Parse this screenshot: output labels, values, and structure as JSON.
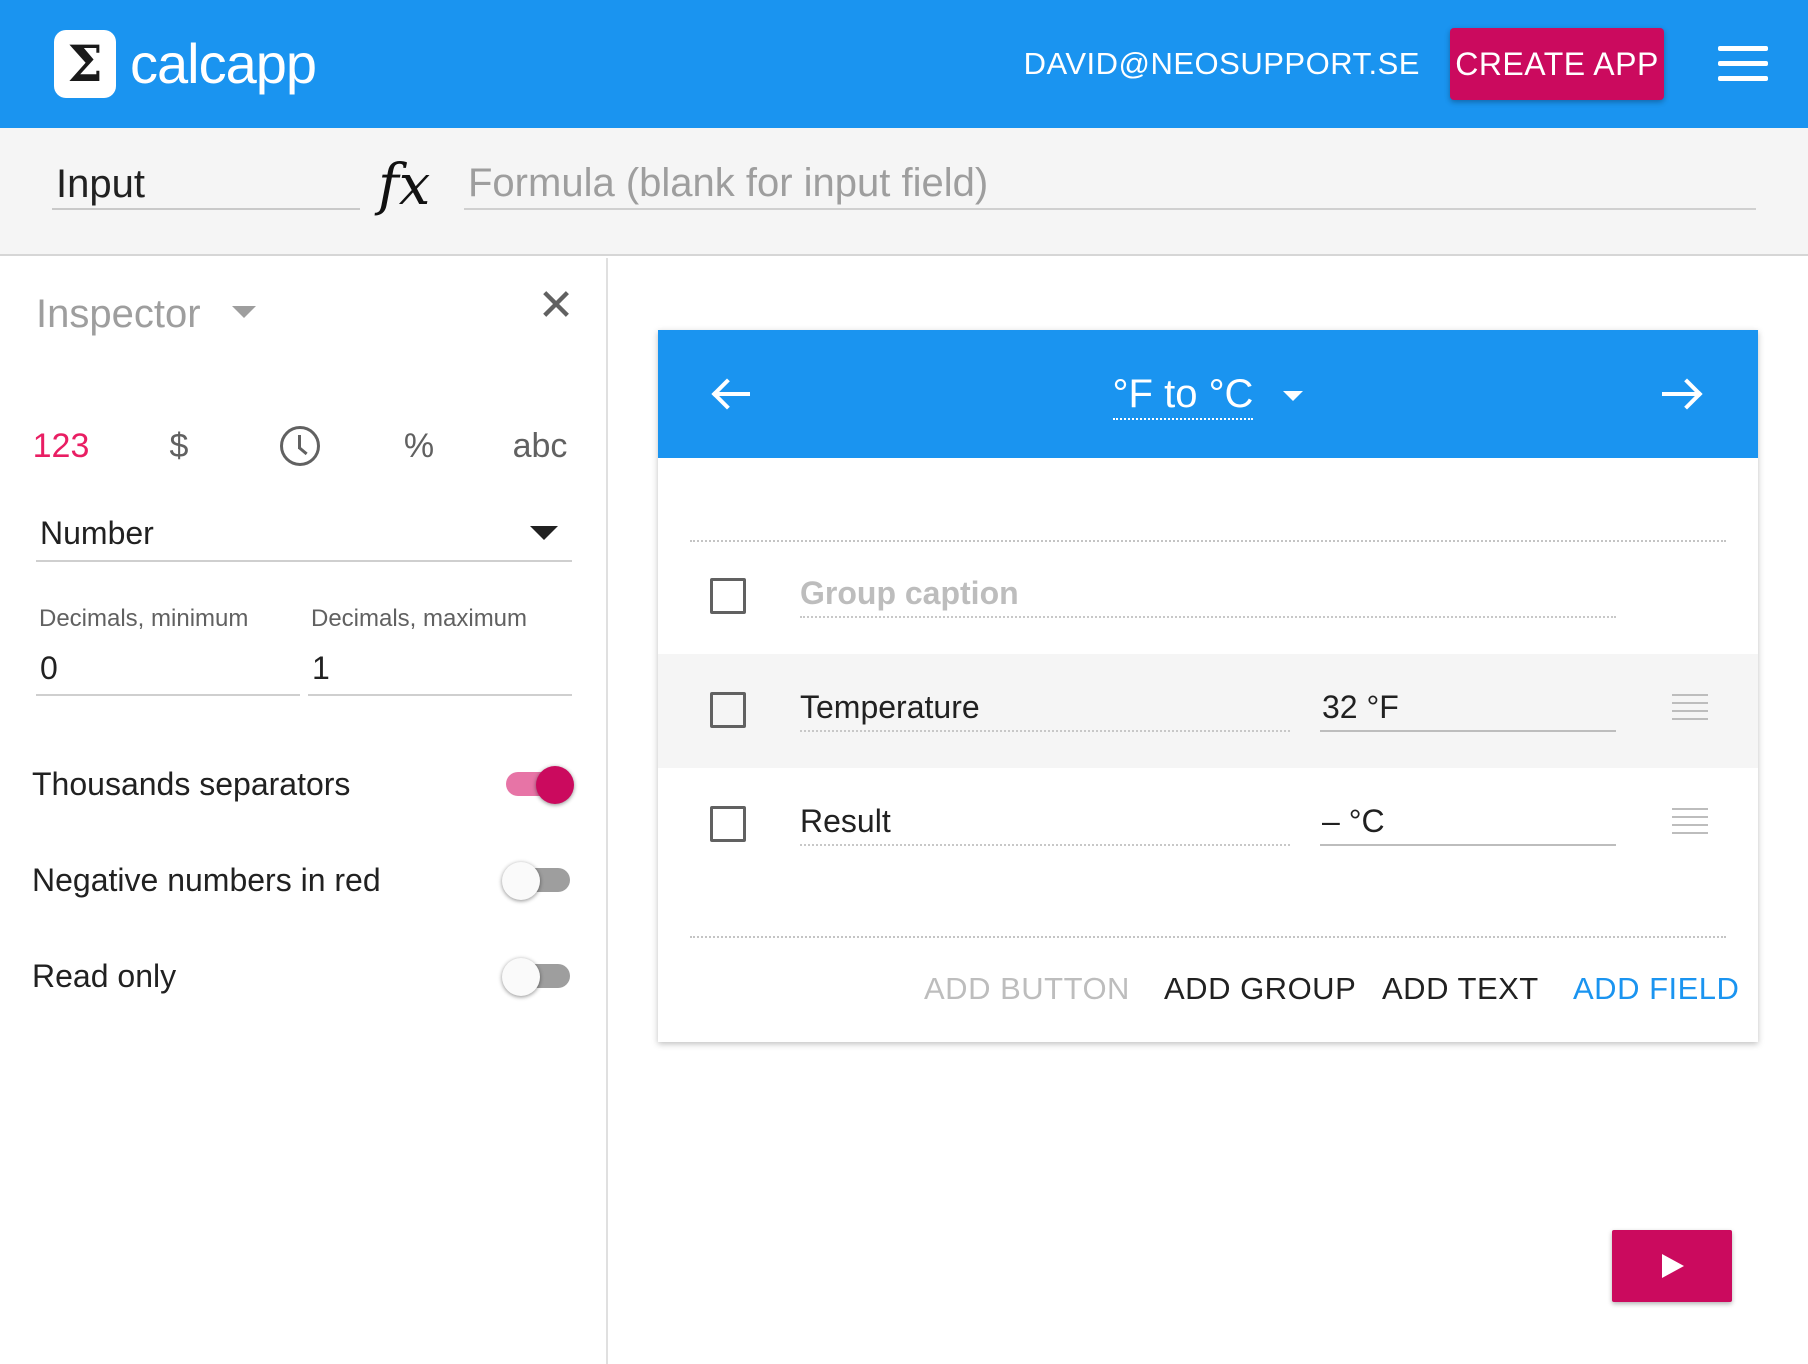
{
  "header": {
    "logo_symbol": "Σ",
    "logo_text": "calcapp",
    "user_email": "DAVID@NEOSUPPORT.SE",
    "create_app_label": "CREATE APP",
    "menu_icon": "hamburger-menu-icon",
    "brand_color": "#1a94f0",
    "accent_color": "#cb0a5e"
  },
  "formula_bar": {
    "name_value": "Input",
    "fx_symbol": "fx",
    "formula_placeholder": "Formula (blank for input field)",
    "formula_value": ""
  },
  "inspector": {
    "title": "Inspector",
    "close_icon": "close-icon",
    "format_tabs": [
      {
        "label": "123",
        "active": true
      },
      {
        "label": "$",
        "active": false
      },
      {
        "label": "",
        "icon": "clock-icon",
        "active": false
      },
      {
        "label": "%",
        "active": false
      },
      {
        "label": "abc",
        "active": false
      }
    ],
    "type_select": {
      "value": "Number"
    },
    "decimals_min": {
      "label": "Decimals, minimum",
      "value": "0"
    },
    "decimals_max": {
      "label": "Decimals, maximum",
      "value": "1"
    },
    "toggles": [
      {
        "label": "Thousands separators",
        "on": true
      },
      {
        "label": "Negative numbers in red",
        "on": false
      },
      {
        "label": "Read only",
        "on": false
      }
    ]
  },
  "app_card": {
    "title": "°F to °C",
    "prev_icon": "arrow-left-icon",
    "next_icon": "arrow-right-icon",
    "group_caption_placeholder": "Group caption",
    "fields": [
      {
        "label": "Temperature",
        "value": "32 °F",
        "selected": true
      },
      {
        "label": "Result",
        "value": "– °C",
        "selected": false
      }
    ],
    "actions": {
      "add_button": "ADD BUTTON",
      "add_group": "ADD GROUP",
      "add_text": "ADD TEXT",
      "add_field": "ADD FIELD"
    }
  },
  "run_button": {
    "icon": "play-icon"
  }
}
